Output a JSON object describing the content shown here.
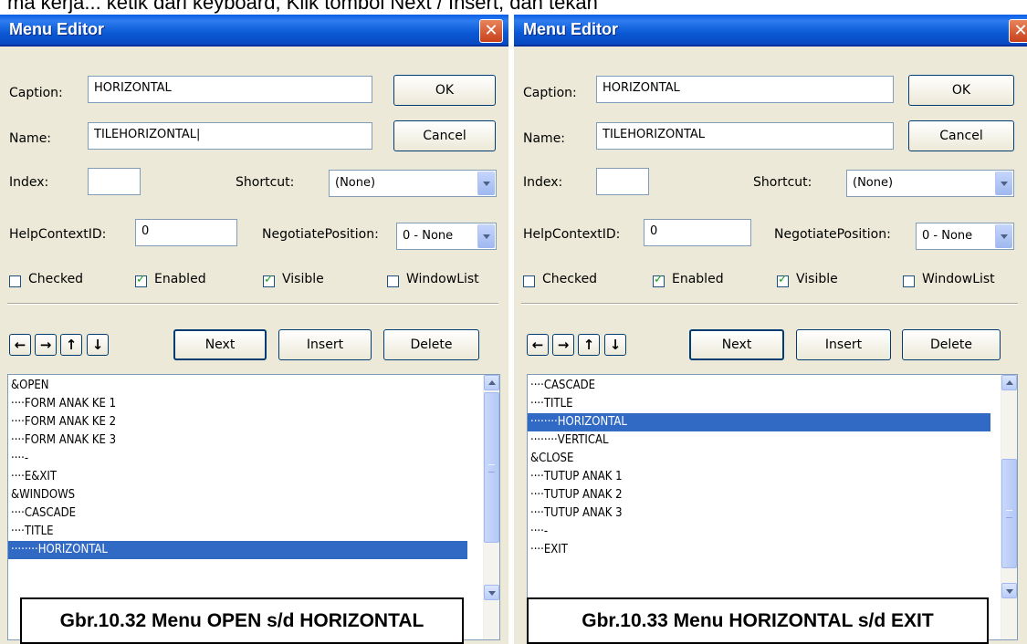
{
  "top_strip": {
    "text": "ma kerja... ketik dari keyboard, Klik tombol Next / Insert, dan tekan"
  },
  "dialogs": [
    {
      "title": "Menu Editor",
      "close_label": "✕",
      "fields": {
        "caption_label": "Caption:",
        "caption_value": "HORIZONTAL",
        "name_label": "Name:",
        "name_value": "TILEHORIZONTAL|",
        "index_label": "Index:",
        "index_value": "",
        "shortcut_label": "Shortcut:",
        "shortcut_value": "(None)",
        "helpcontext_label": "HelpContextID:",
        "helpcontext_value": "0",
        "negotiate_label": "NegotiatePosition:",
        "negotiate_value": "0 - None"
      },
      "buttons": {
        "ok": "OK",
        "cancel": "Cancel",
        "next": "Next",
        "insert": "Insert",
        "delete": "Delete"
      },
      "checkboxes": [
        {
          "label": "Checked",
          "checked": false
        },
        {
          "label": "Enabled",
          "checked": true
        },
        {
          "label": "Visible",
          "checked": true
        },
        {
          "label": "WindowList",
          "checked": false
        }
      ],
      "arrows": [
        "←",
        "→",
        "↑",
        "↓"
      ],
      "menu_items": [
        "&OPEN",
        "····FORM ANAK KE 1",
        "····FORM ANAK KE 2",
        "····FORM ANAK KE 3",
        "····-",
        "····E&XIT",
        "&WINDOWS",
        "····CASCADE",
        "····TITLE",
        "········HORIZONTAL"
      ],
      "selected_index": 9,
      "figure_caption": "Gbr.10.32 Menu OPEN s/d HORIZONTAL"
    },
    {
      "title": "Menu Editor",
      "close_label": "✕",
      "fields": {
        "caption_label": "Caption:",
        "caption_value": "HORIZONTAL",
        "name_label": "Name:",
        "name_value": "TILEHORIZONTAL",
        "index_label": "Index:",
        "index_value": "",
        "shortcut_label": "Shortcut:",
        "shortcut_value": "(None)",
        "helpcontext_label": "HelpContextID:",
        "helpcontext_value": "0",
        "negotiate_label": "NegotiatePosition:",
        "negotiate_value": "0 - None"
      },
      "buttons": {
        "ok": "OK",
        "cancel": "Cancel",
        "next": "Next",
        "insert": "Insert",
        "delete": "Delete"
      },
      "checkboxes": [
        {
          "label": "Checked",
          "checked": false
        },
        {
          "label": "Enabled",
          "checked": true
        },
        {
          "label": "Visible",
          "checked": true
        },
        {
          "label": "WindowList",
          "checked": false
        }
      ],
      "arrows": [
        "←",
        "→",
        "↑",
        "↓"
      ],
      "menu_items": [
        "····CASCADE",
        "····TITLE",
        "········HORIZONTAL",
        "········VERTICAL",
        "&CLOSE",
        "····TUTUP ANAK 1",
        "····TUTUP ANAK 2",
        "····TUTUP ANAK 3",
        "····-",
        "····EXIT"
      ],
      "selected_index": 2,
      "figure_caption": "Gbr.10.33  Menu HORIZONTAL s/d EXIT"
    }
  ],
  "colors": {
    "titlebar": "#0a5ee6",
    "dialog_bg": "#ece9d8",
    "selection": "#316ac5",
    "close_button": "#c7411c"
  }
}
